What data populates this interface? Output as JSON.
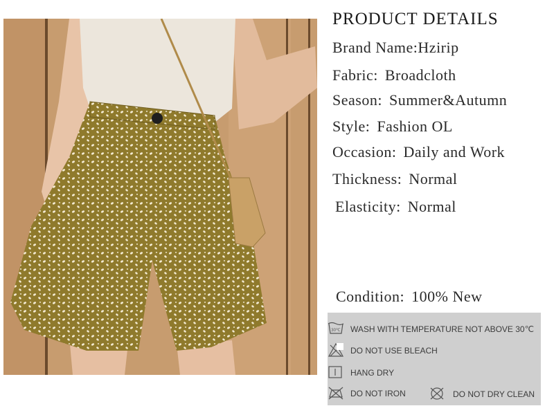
{
  "title": "PRODUCT DETAILS",
  "details": [
    {
      "key": "Brand Name",
      "sep": ":",
      "value": "Hzirip"
    },
    {
      "key": "Fabric",
      "sep": ":",
      "value": "Broadcloth"
    },
    {
      "key": "Season",
      "sep": ":",
      "value": "Summer&Autumn"
    },
    {
      "key": "Style",
      "sep": ":",
      "value": "Fashion OL"
    },
    {
      "key": "Occasion",
      "sep": ":",
      "value": "Daily and Work"
    },
    {
      "key": "Thickness",
      "sep": ":",
      "value": "Normal"
    },
    {
      "key": "Elasticity",
      "sep": ":",
      "value": "Normal"
    }
  ],
  "condition": {
    "key": "Condition",
    "sep": ":",
    "value": "100% New"
  },
  "care": {
    "wash": "WASH WITH TEMPERATURE NOT ABOVE 30℃",
    "wash_icon_text": "30℃",
    "bleach": "DO NOT USE BLEACH",
    "dry": "HANG DRY",
    "iron": "DO NOT IRON",
    "dry_clean": "DO NOT DRY CLEAN"
  },
  "colors": {
    "shorts": "#8f7a2c",
    "top": "#ece6dc",
    "wall": "#c69b6e",
    "care_bg": "#cfcfcf"
  }
}
